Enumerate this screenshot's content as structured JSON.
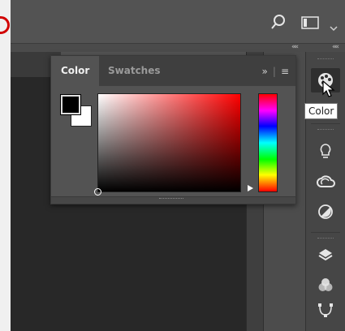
{
  "topbar": {
    "icons": [
      "search-icon",
      "workspace-layout-icon",
      "chevron-down-icon"
    ]
  },
  "collapse": {
    "left_label": "««",
    "right_label": "««"
  },
  "color_panel": {
    "tabs": [
      {
        "label": "Color",
        "active": true
      },
      {
        "label": "Swatches",
        "active": false
      }
    ],
    "overflow_label": "»",
    "menu_label": "≡",
    "foreground_color": "#000000",
    "background_color": "#ffffff"
  },
  "toolstrip": {
    "icons": [
      "color-palette-icon",
      "lightbulb-icon",
      "creative-cloud-icon",
      "adjustments-icon",
      "layers-icon",
      "channels-icon",
      "paths-icon"
    ],
    "active": "color-palette-icon"
  },
  "tooltip": {
    "text": "Color"
  }
}
